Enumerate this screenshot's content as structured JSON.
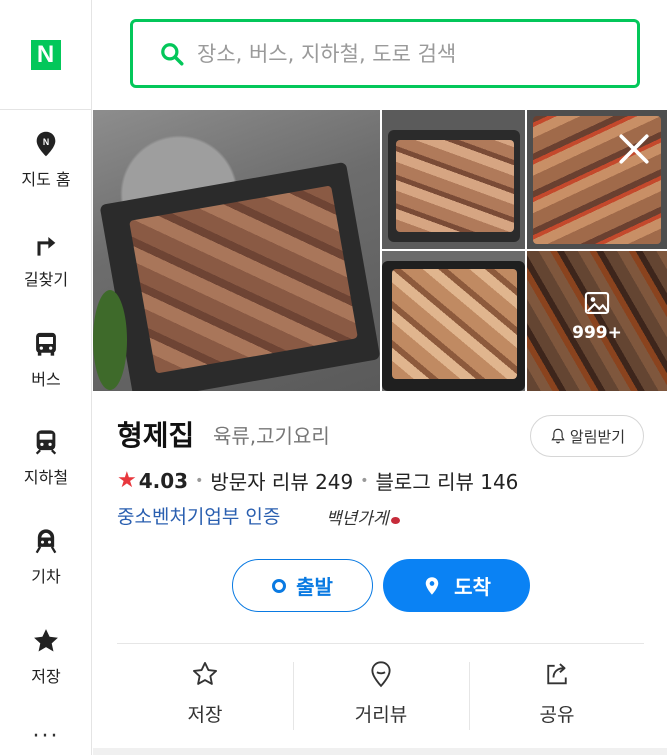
{
  "app": {
    "logo_text": "N",
    "brand_color": "#03c75a",
    "accent_color": "#0a82f4"
  },
  "sidebar": {
    "items": [
      {
        "label": "지도 홈",
        "icon": "map-pin-icon"
      },
      {
        "label": "길찾기",
        "icon": "turn-right-arrow-icon"
      },
      {
        "label": "버스",
        "icon": "bus-icon"
      },
      {
        "label": "지하철",
        "icon": "subway-icon"
      },
      {
        "label": "기차",
        "icon": "train-icon"
      },
      {
        "label": "저장",
        "icon": "star-icon"
      }
    ],
    "more_label": "···"
  },
  "search": {
    "placeholder": "장소, 버스, 지하철, 도로 검색",
    "value": ""
  },
  "photos": {
    "more_count": "999+"
  },
  "place": {
    "name": "형제집",
    "category": "육류,고기요리",
    "alarm_label": "알림받기",
    "rating": "4.03",
    "visitor_review": "방문자 리뷰 249",
    "blog_review": "블로그 리뷰 146",
    "certification": "중소벤처기업부 인증",
    "cert_badge": "백년가게"
  },
  "route": {
    "depart_label": "출발",
    "arrive_label": "도착"
  },
  "actions": [
    {
      "label": "저장",
      "icon": "star-outline-icon"
    },
    {
      "label": "거리뷰",
      "icon": "street-view-pin-icon"
    },
    {
      "label": "공유",
      "icon": "share-icon"
    }
  ]
}
